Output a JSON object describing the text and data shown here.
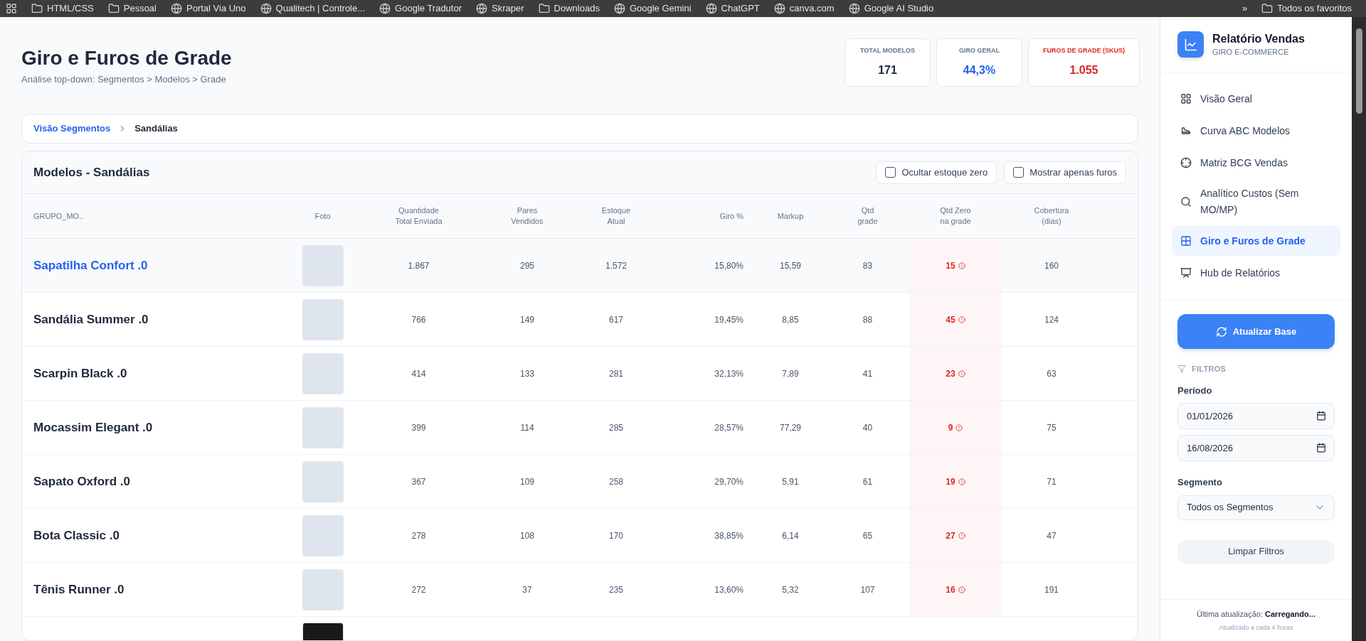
{
  "bookmarks": [
    {
      "label": "HTML/CSS",
      "kind": "folder"
    },
    {
      "label": "Pessoal",
      "kind": "folder"
    },
    {
      "label": "Portal Via Uno",
      "kind": "site"
    },
    {
      "label": "Qualitech | Controle...",
      "kind": "site"
    },
    {
      "label": "Google Tradutor",
      "kind": "site"
    },
    {
      "label": "Skraper",
      "kind": "site"
    },
    {
      "label": "Downloads",
      "kind": "folder"
    },
    {
      "label": "Google Gemini",
      "kind": "site"
    },
    {
      "label": "ChatGPT",
      "kind": "site"
    },
    {
      "label": "canva.com",
      "kind": "site"
    },
    {
      "label": "Google AI Studio",
      "kind": "site"
    }
  ],
  "bookmarks_more": "»",
  "all_bookmarks": "Todos os favoritos",
  "header": {
    "title": "Giro e Furos de Grade",
    "subtitle": "Análise top-down: Segmentos > Modelos > Grade"
  },
  "kpis": [
    {
      "label": "TOTAL MODELOS",
      "value": "171",
      "kind": "neutral"
    },
    {
      "label": "GIRO GERAL",
      "value": "44,3%",
      "kind": "info"
    },
    {
      "label": "FUROS DE GRADE (SKUS)",
      "value": "1.055",
      "kind": "alert"
    }
  ],
  "breadcrumb": [
    {
      "label": "Visão Segmentos",
      "selected": false
    },
    {
      "label": "Sandálias",
      "selected": true
    }
  ],
  "table": {
    "title": "Modelos - Sandálias",
    "filters": [
      {
        "label": "Ocultar estoque zero",
        "checked": false
      },
      {
        "label": "Mostrar apenas furos",
        "checked": false
      }
    ],
    "name_column": "GRUPO_MO..",
    "photo_column": "Foto",
    "columns": [
      "Quantidade Total Enviada",
      "Pares Vendidos",
      "Estoque Atual",
      "Giro %",
      "Markup",
      "Qtd grade",
      "Qtd Zero na grade",
      "Cobertura (dias)"
    ],
    "rows": [
      {
        "name": "Sapatilha Confort .0",
        "selected": true,
        "cells": [
          "1.867",
          "295",
          "1.572",
          "15,80%",
          "15,59",
          "83",
          "15",
          "160"
        ]
      },
      {
        "name": "Sandália Summer .0",
        "selected": false,
        "cells": [
          "766",
          "149",
          "617",
          "19,45%",
          "8,85",
          "88",
          "45",
          "124"
        ]
      },
      {
        "name": "Scarpin Black .0",
        "selected": false,
        "cells": [
          "414",
          "133",
          "281",
          "32,13%",
          "7,89",
          "41",
          "23",
          "63"
        ]
      },
      {
        "name": "Mocassim Elegant .0",
        "selected": false,
        "cells": [
          "399",
          "114",
          "285",
          "28,57%",
          "77,29",
          "40",
          "9",
          "75"
        ]
      },
      {
        "name": "Sapato Oxford .0",
        "selected": false,
        "cells": [
          "367",
          "109",
          "258",
          "29,70%",
          "5,91",
          "61",
          "19",
          "71"
        ]
      },
      {
        "name": "Bota Classic .0",
        "selected": false,
        "cells": [
          "278",
          "108",
          "170",
          "38,85%",
          "6,14",
          "65",
          "27",
          "47"
        ]
      },
      {
        "name": "Tênis Runner .0",
        "selected": false,
        "cells": [
          "272",
          "37",
          "235",
          "13,60%",
          "5,32",
          "107",
          "16",
          "191"
        ]
      }
    ]
  },
  "sidebar": {
    "title": "Relatório Vendas",
    "subtitle": "GIRO E-COMMERCE",
    "items": [
      {
        "label": "Visão Geral",
        "selected": false
      },
      {
        "label": "Curva ABC Modelos",
        "selected": false
      },
      {
        "label": "Matriz BCG Vendas",
        "selected": false
      },
      {
        "label": "Analítico Custos (Sem MO/MP)",
        "selected": false
      },
      {
        "label": "Giro e Furos de Grade",
        "selected": true
      },
      {
        "label": "Hub de Relatórios",
        "selected": false
      }
    ],
    "refresh_button": "Atualizar Base",
    "filters_heading": "FILTROS",
    "period_label": "Período",
    "date_from": "01/01/2026",
    "date_to": "16/08/2026",
    "segment_label": "Segmento",
    "segment_value": "Todos os Segmentos",
    "clear_button": "Limpar Filtros",
    "last_update_label": "Última atualização:",
    "last_update_value": "Carregando...",
    "update_note": "Atualizado a cada 4 horas"
  }
}
